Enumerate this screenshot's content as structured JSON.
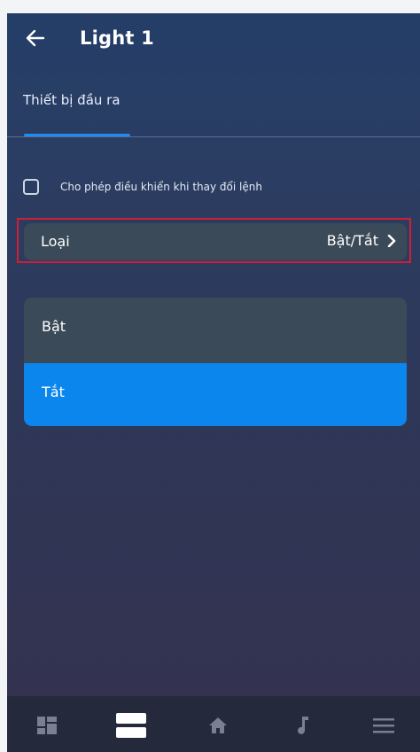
{
  "header": {
    "title": "Light 1",
    "back_icon": "arrow-left-icon"
  },
  "tabs": [
    {
      "label": "Thiết bị đầu ra",
      "active": true
    }
  ],
  "option_checkbox": {
    "label": "Cho phép điều khiển khi thay đổi lệnh",
    "checked": false
  },
  "type_row": {
    "label": "Loại",
    "value": "Bật/Tắt",
    "icon": "chevron-right-icon"
  },
  "options": [
    {
      "label": "Bật",
      "selected": false
    },
    {
      "label": "Tắt",
      "selected": true
    }
  ],
  "bottom_nav": [
    {
      "icon": "dashboard-icon",
      "active": false
    },
    {
      "icon": "devices-list-icon",
      "active": true
    },
    {
      "icon": "home-icon",
      "active": false
    },
    {
      "icon": "music-note-icon",
      "active": false
    },
    {
      "icon": "menu-icon",
      "active": false
    }
  ],
  "colors": {
    "accent": "#0b86ec",
    "highlight_border": "#d21d36",
    "card": "#3b4a58",
    "nav_background": "#24293b"
  }
}
